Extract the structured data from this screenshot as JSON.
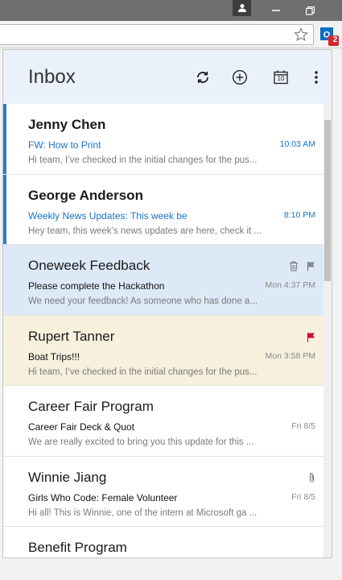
{
  "popup": {
    "title": "Inbox"
  },
  "header_icons": [
    "sync-icon",
    "add-icon",
    "calendar-icon",
    "more-icon"
  ],
  "calendar_day": "10",
  "extension_badge": "2",
  "messages": [
    {
      "sender": "Jenny Chen",
      "subject": "FW: How to Print",
      "time": "10:03 AM",
      "preview": "Hi team, I’ve checked in the initial changes for the pus...",
      "unread": true,
      "state": "normal"
    },
    {
      "sender": "George Anderson",
      "subject": "Weekly News Updates: This week be",
      "time": "8:10 PM",
      "preview": "Hey team, this week’s news updates are here, check it ...",
      "unread": true,
      "state": "normal"
    },
    {
      "sender": "Oneweek Feedback",
      "subject": "Please complete the Hackathon",
      "time": "Mon 4:37 PM",
      "preview": "We need your feedback! As someone who has done a...",
      "unread": false,
      "state": "selected"
    },
    {
      "sender": "Rupert Tanner",
      "subject": "Boat Trips!!!",
      "time": "Mon 3:58 PM",
      "preview": "Hi team, I’ve checked in the initial changes for the pus...",
      "unread": false,
      "state": "flagged"
    },
    {
      "sender": "Career Fair Program",
      "subject": "Career Fair Deck & Quot",
      "time": "Fri 8/5",
      "preview": "We are really excited to bring you this update for this ...",
      "unread": false,
      "state": "normal"
    },
    {
      "sender": "Winnie Jiang",
      "subject": "Girls Who Code: Female Volunteer",
      "time": "Fri 8/5",
      "preview": "Hi all! This is Winnie, one of the intern at Microsoft ga ...",
      "unread": false,
      "state": "attachment"
    },
    {
      "sender": "Benefit Program",
      "subject": "",
      "time": "",
      "preview": "",
      "unread": false,
      "state": "normal"
    }
  ],
  "colors": {
    "accent": "#2b7cd3",
    "selected_bg": "#dde9f7",
    "flagged_bg": "#f6f0dc",
    "flag_red": "#c8102e"
  }
}
